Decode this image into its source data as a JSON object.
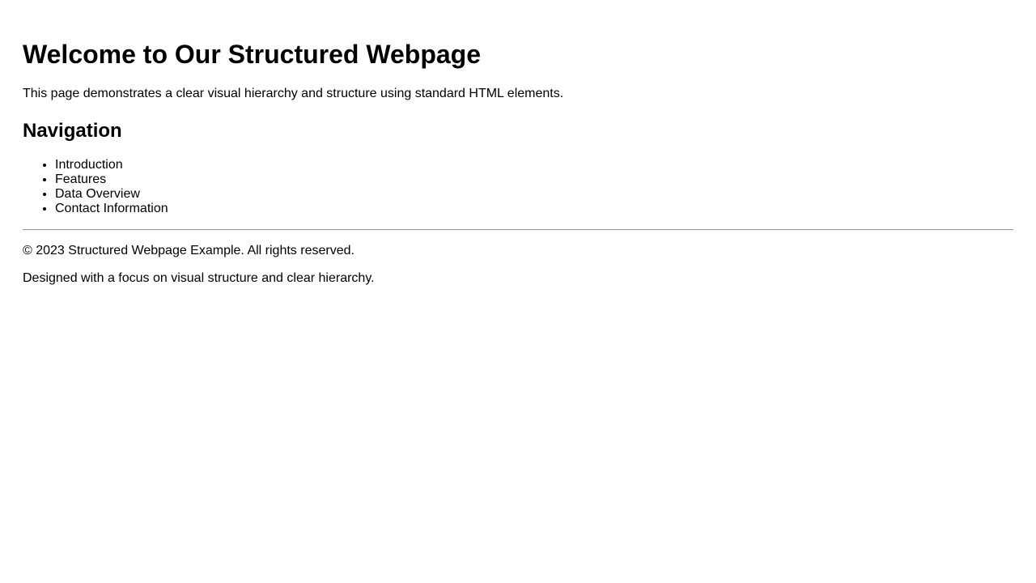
{
  "header": {
    "title": "Welcome to Our Structured Webpage",
    "intro": "This page demonstrates a clear visual hierarchy and structure using standard HTML elements."
  },
  "navigation": {
    "heading": "Navigation",
    "items": [
      {
        "label": "Introduction"
      },
      {
        "label": "Features"
      },
      {
        "label": "Data Overview"
      },
      {
        "label": "Contact Information"
      }
    ]
  },
  "footer": {
    "copyright": "© 2023 Structured Webpage Example. All rights reserved.",
    "tagline": "Designed with a focus on visual structure and clear hierarchy."
  },
  "colors": {
    "text": "#000000",
    "background": "#ffffff",
    "divider": "#999999"
  }
}
